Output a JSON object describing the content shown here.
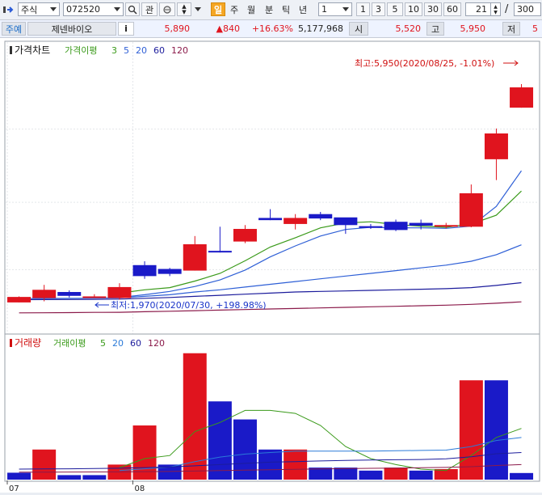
{
  "toolbar": {
    "market": "주식",
    "code": "072520",
    "btn_interest": "관",
    "period_buttons": [
      "일",
      "주",
      "월",
      "분",
      "틱",
      "년"
    ],
    "active_period": "일",
    "unit_value": "1",
    "quick_buttons": [
      "1",
      "3",
      "5",
      "10",
      "30",
      "60"
    ],
    "count_value": "21",
    "slash": "/",
    "total_value": "300"
  },
  "quote": {
    "tag": "주예",
    "name": "제넨바이오",
    "info_icon": "i",
    "price": "5,890",
    "change": "▲840",
    "change_rate": "+16.63%",
    "volume": "5,177,968",
    "open_label": "시",
    "open": "5,520",
    "high_label": "고",
    "high": "5,950",
    "low_label": "저",
    "low": "5"
  },
  "colors": {
    "up": "#e0141e",
    "down": "#1a1ac8",
    "ma5": "#3a9a1a",
    "ma20": "#2e5fd6",
    "ma60": "#1c1c9c",
    "ma120": "#8b1a4a",
    "vol_ma5": "#3a9a1a",
    "vol_ma20": "#2a7ad8",
    "vol_ma60": "#1c1c9c",
    "vol_ma120": "#8b1a4a"
  },
  "chart_data": [
    {
      "type": "candlestick",
      "title": "가격차트",
      "legend": [
        {
          "label": "가격이평",
          "color": "#3a9a1a"
        },
        {
          "label": "3",
          "color": "#3a9a1a"
        },
        {
          "label": "5",
          "color": "#2e5fd6"
        },
        {
          "label": "20",
          "color": "#2e5fd6"
        },
        {
          "label": "60",
          "color": "#1c1c9c"
        },
        {
          "label": "120",
          "color": "#8b1a4a"
        }
      ],
      "ylim": [
        1600,
        6200
      ],
      "x_tick_labels": [
        {
          "index": 0,
          "label": "07"
        },
        {
          "index": 5,
          "label": "08"
        }
      ],
      "candles": [
        {
          "o": 1970,
          "h": 2080,
          "l": 1970,
          "c": 2070
        },
        {
          "o": 2050,
          "h": 2290,
          "l": 1990,
          "c": 2200
        },
        {
          "o": 2160,
          "h": 2190,
          "l": 2060,
          "c": 2090
        },
        {
          "o": 2080,
          "h": 2120,
          "l": 2050,
          "c": 2080
        },
        {
          "o": 2050,
          "h": 2320,
          "l": 2020,
          "c": 2250
        },
        {
          "o": 2650,
          "h": 2720,
          "l": 2400,
          "c": 2450
        },
        {
          "o": 2580,
          "h": 2600,
          "l": 2450,
          "c": 2490
        },
        {
          "o": 2550,
          "h": 3180,
          "l": 2550,
          "c": 3030
        },
        {
          "o": 2910,
          "h": 3350,
          "l": 2880,
          "c": 2890
        },
        {
          "o": 3080,
          "h": 3380,
          "l": 3050,
          "c": 3310
        },
        {
          "o": 3510,
          "h": 3670,
          "l": 3470,
          "c": 3470
        },
        {
          "o": 3400,
          "h": 3580,
          "l": 3300,
          "c": 3510
        },
        {
          "o": 3580,
          "h": 3620,
          "l": 3470,
          "c": 3500
        },
        {
          "o": 3520,
          "h": 3510,
          "l": 3220,
          "c": 3380
        },
        {
          "o": 3360,
          "h": 3400,
          "l": 3310,
          "c": 3340
        },
        {
          "o": 3440,
          "h": 3480,
          "l": 3270,
          "c": 3290
        },
        {
          "o": 3420,
          "h": 3480,
          "l": 3300,
          "c": 3370
        },
        {
          "o": 3370,
          "h": 3420,
          "l": 3320,
          "c": 3380
        },
        {
          "o": 3350,
          "h": 4120,
          "l": 3340,
          "c": 3960
        },
        {
          "o": 4580,
          "h": 5140,
          "l": 4200,
          "c": 5050
        },
        {
          "o": 5520,
          "h": 5950,
          "l": 5520,
          "c": 5890
        }
      ],
      "ma_series": [
        {
          "name": "5",
          "color": "#3a9a1a",
          "values": [
            null,
            null,
            null,
            null,
            2140,
            2200,
            2240,
            2360,
            2500,
            2730,
            2980,
            3150,
            3330,
            3420,
            3440,
            3390,
            3360,
            3340,
            3400,
            3560,
            4000
          ]
        },
        {
          "name": "20",
          "color": "#2e5fd6",
          "values": [
            null,
            null,
            null,
            null,
            2060,
            2110,
            2170,
            2260,
            2380,
            2560,
            2800,
            3000,
            3180,
            3300,
            3340,
            3330,
            3330,
            3320,
            3360,
            3720,
            4370
          ]
        },
        {
          "name": "60",
          "color": "#2e5fd6",
          "values": [
            2040,
            2042,
            2044,
            2047,
            2052,
            2080,
            2110,
            2160,
            2200,
            2250,
            2300,
            2350,
            2400,
            2450,
            2500,
            2550,
            2600,
            2650,
            2720,
            2840,
            3020
          ]
        },
        {
          "name": "120",
          "color": "#1c1c9c",
          "values": [
            2020,
            2021,
            2023,
            2025,
            2030,
            2045,
            2060,
            2080,
            2100,
            2120,
            2140,
            2160,
            2170,
            2180,
            2190,
            2200,
            2210,
            2220,
            2240,
            2280,
            2330
          ]
        },
        {
          "name": "ma_long",
          "color": "#8b1a4a",
          "values": [
            1780,
            1782,
            1785,
            1788,
            1790,
            1800,
            1810,
            1820,
            1830,
            1840,
            1850,
            1860,
            1870,
            1880,
            1890,
            1900,
            1910,
            1920,
            1935,
            1955,
            1980
          ]
        }
      ],
      "annotations": {
        "high_label": "최고:5,950(2020/08/25, -1.01%)",
        "low_label": "최저:1,970(2020/07/30, +198.98%)"
      }
    },
    {
      "type": "bar",
      "title": "거래량",
      "legend": [
        {
          "label": "거래이평",
          "color": "#3a9a1a"
        },
        {
          "label": "5",
          "color": "#3a9a1a"
        },
        {
          "label": "20",
          "color": "#2a7ad8"
        },
        {
          "label": "60",
          "color": "#1c1c9c"
        },
        {
          "label": "120",
          "color": "#8b1a4a"
        }
      ],
      "ylim": [
        0,
        4300000
      ],
      "values": [
        {
          "v": 230000,
          "up": false
        },
        {
          "v": 1000000,
          "up": true
        },
        {
          "v": 150000,
          "up": false
        },
        {
          "v": 150000,
          "up": false
        },
        {
          "v": 500000,
          "up": true
        },
        {
          "v": 1800000,
          "up": true
        },
        {
          "v": 500000,
          "up": false
        },
        {
          "v": 4200000,
          "up": true
        },
        {
          "v": 2600000,
          "up": false
        },
        {
          "v": 2000000,
          "up": false
        },
        {
          "v": 1000000,
          "up": false
        },
        {
          "v": 1000000,
          "up": true
        },
        {
          "v": 400000,
          "up": false
        },
        {
          "v": 400000,
          "up": false
        },
        {
          "v": 300000,
          "up": false
        },
        {
          "v": 400000,
          "up": true
        },
        {
          "v": 300000,
          "up": false
        },
        {
          "v": 350000,
          "up": true
        },
        {
          "v": 3300000,
          "up": true
        },
        {
          "v": 3300000,
          "up": false
        },
        {
          "v": 220000,
          "up": false
        }
      ],
      "ma_series": [
        {
          "name": "5",
          "color": "#3a9a1a",
          "values": [
            null,
            null,
            null,
            null,
            400000,
            700000,
            800000,
            1600000,
            1900000,
            2300000,
            2300000,
            2200000,
            1800000,
            1100000,
            700000,
            500000,
            350000,
            300000,
            800000,
            1400000,
            1700000
          ]
        },
        {
          "name": "20",
          "color": "#2a7ad8",
          "values": [
            null,
            null,
            null,
            null,
            300000,
            360000,
            420000,
            600000,
            750000,
            850000,
            900000,
            950000,
            950000,
            950000,
            950000,
            960000,
            970000,
            980000,
            1100000,
            1300000,
            1400000
          ]
        },
        {
          "name": "60",
          "color": "#1c1c9c",
          "values": [
            350000,
            355000,
            360000,
            370000,
            380000,
            400000,
            420000,
            460000,
            500000,
            540000,
            580000,
            600000,
            620000,
            640000,
            650000,
            660000,
            670000,
            690000,
            760000,
            860000,
            900000
          ]
        },
        {
          "name": "120",
          "color": "#8b1a4a",
          "values": [
            250000,
            250000,
            252000,
            255000,
            258000,
            265000,
            272000,
            285000,
            300000,
            315000,
            330000,
            345000,
            355000,
            365000,
            375000,
            385000,
            395000,
            405000,
            430000,
            470000,
            500000
          ]
        }
      ]
    }
  ]
}
